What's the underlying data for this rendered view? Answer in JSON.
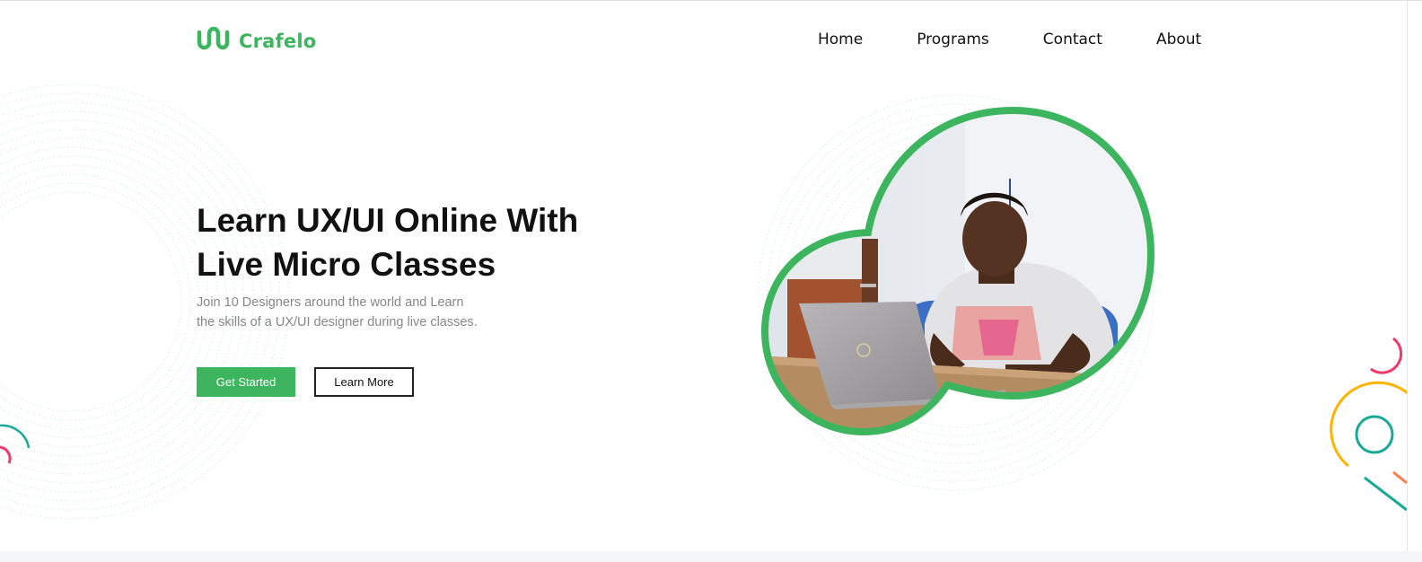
{
  "brand": {
    "name": "Crafelo",
    "color": "#3cb55e"
  },
  "nav": {
    "items": [
      "Home",
      "Programs",
      "Contact",
      "About"
    ]
  },
  "hero": {
    "title_lines": [
      "Learn UX/UI Online With",
      "Live Micro Classes"
    ],
    "subtitle_lines": [
      "Join 10 Designers around the world and Learn",
      "the skills of a UX/UI designer during live classes."
    ],
    "primary_button": "Get Started",
    "secondary_button": "Learn More"
  },
  "illustration": {
    "subject": "student working on a laptop",
    "frame_color": "#3cb55e"
  },
  "colors": {
    "accent": "#3cb55e",
    "text": "#111111",
    "muted": "#888888",
    "deco_pink": "#f0386b",
    "deco_teal": "#18a999",
    "deco_yellow": "#ffb400",
    "deco_orange": "#ff7a45"
  }
}
